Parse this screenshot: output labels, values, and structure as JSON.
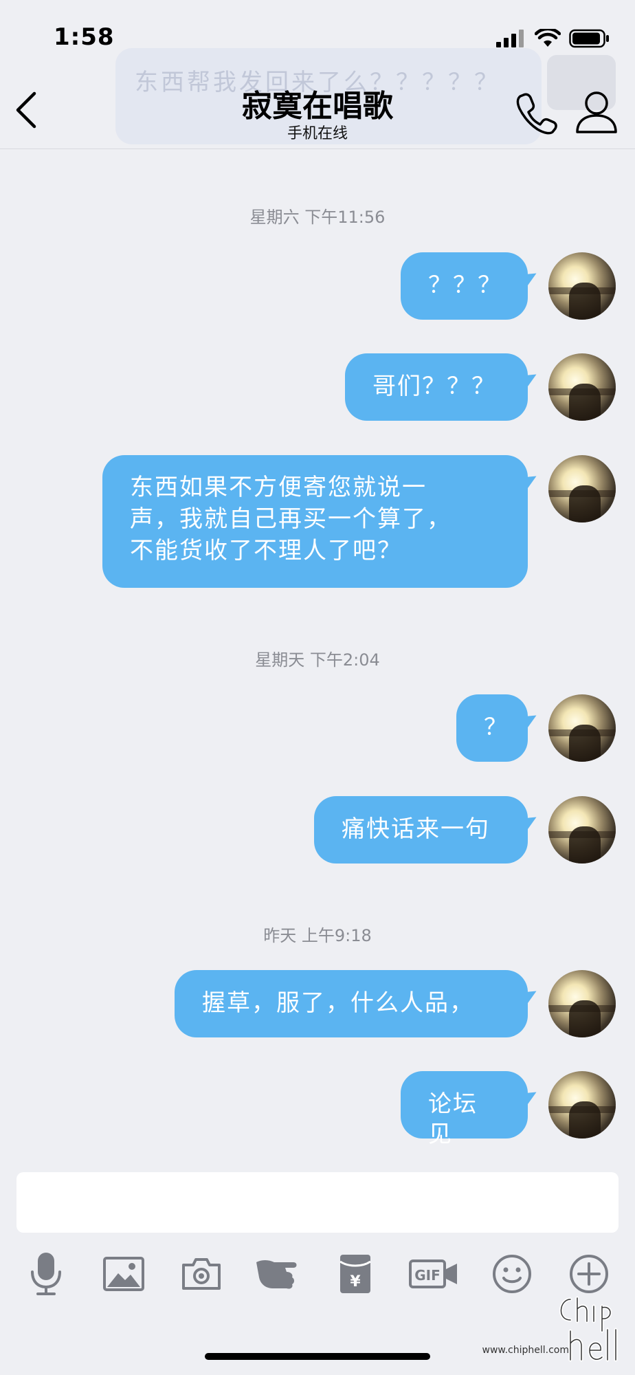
{
  "status_bar": {
    "time": "1:58"
  },
  "background_notification": {
    "text": "东西帮我发回来了么？？？？？"
  },
  "header": {
    "title": "寂寞在唱歌",
    "subtitle": "手机在线"
  },
  "messages": [
    {
      "type": "timestamp",
      "text": "星期六 下午11:56"
    },
    {
      "type": "sent",
      "text": "？？？"
    },
    {
      "type": "sent",
      "text": "哥们？？？"
    },
    {
      "type": "sent",
      "lines": [
        "东西如果不方便寄您就说一",
        "声，我就自己再买一个算了，",
        "不能货收了不理人了吧？"
      ]
    },
    {
      "type": "timestamp",
      "text": "星期天 下午2:04"
    },
    {
      "type": "sent",
      "text": "？"
    },
    {
      "type": "sent",
      "text": "痛快话来一句"
    },
    {
      "type": "timestamp",
      "text": "昨天 上午9:18"
    },
    {
      "type": "sent",
      "text": "握草，服了，什么人品，"
    },
    {
      "type": "sent",
      "text": "论坛见"
    }
  ],
  "composer": {
    "value": "",
    "tools": [
      "microphone-icon",
      "image-icon",
      "camera-icon",
      "poke-hand-icon",
      "red-packet-icon",
      "gif-icon",
      "emoji-icon",
      "plus-icon"
    ]
  },
  "watermark": {
    "site": "www.chiphell.com"
  },
  "colors": {
    "bubble": "#5bb4f1",
    "background": "#eeeff3",
    "icon_gray": "#7a7d85"
  }
}
